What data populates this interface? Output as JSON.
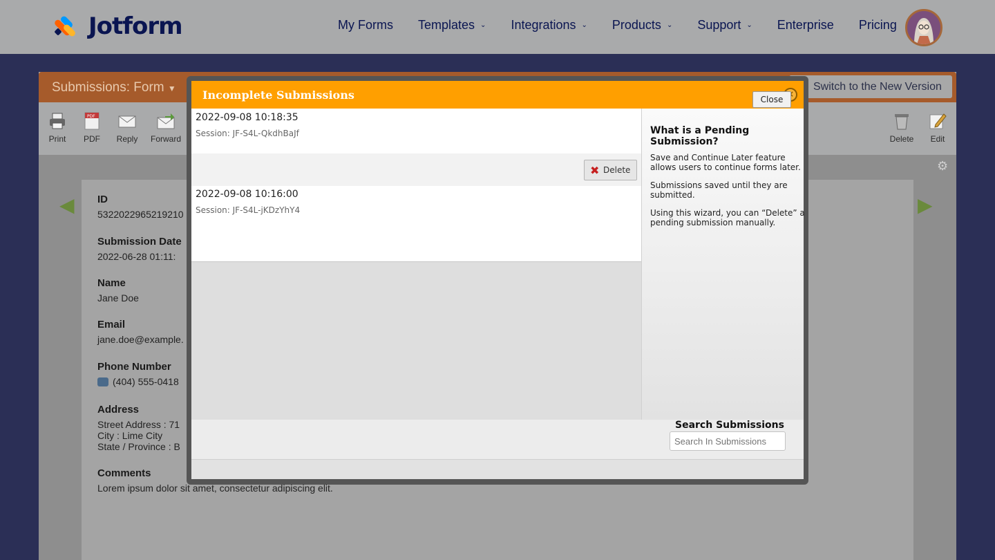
{
  "brand": {
    "name": "Jotform",
    "colors": [
      "#0099ff",
      "#ff6100",
      "#ffb629",
      "#0a1551"
    ]
  },
  "nav": {
    "items": [
      {
        "label": "My Forms",
        "dropdown": false
      },
      {
        "label": "Templates",
        "dropdown": true
      },
      {
        "label": "Integrations",
        "dropdown": true
      },
      {
        "label": "Products",
        "dropdown": true
      },
      {
        "label": "Support",
        "dropdown": true
      },
      {
        "label": "Enterprise",
        "dropdown": false
      },
      {
        "label": "Pricing",
        "dropdown": false
      }
    ],
    "avatar_icon": "user-avatar-icon"
  },
  "submissions": {
    "title": "Submissions: Form",
    "switch_label": "Switch to the New Version",
    "toolbar": {
      "print": "Print",
      "pdf": "PDF",
      "reply": "Reply",
      "forward": "Forward",
      "delete": "Delete",
      "edit": "Edit"
    },
    "fields": [
      {
        "label": "ID",
        "value": "5322022965219210"
      },
      {
        "label": "Submission Date",
        "value": "2022-06-28 01:11:"
      },
      {
        "label": "Name",
        "value": "Jane Doe"
      },
      {
        "label": "Email",
        "value": "jane.doe@example."
      },
      {
        "label": "Phone Number",
        "value": "(404) 555-0418"
      },
      {
        "label": "Address",
        "value": "Street Address : 71",
        "value2": "City : Lime City",
        "value3": "State / Province : B"
      },
      {
        "label": "Comments",
        "value": "Lorem ipsum dolor sit amet, consectetur adipiscing elit."
      }
    ]
  },
  "modal": {
    "title": "Incomplete Submissions",
    "entries": [
      {
        "date": "2022-09-08 10:18:35",
        "session": "Session: JF-S4L-QkdhBaJf"
      },
      {
        "date": "2022-09-08 10:16:00",
        "session": "Session: JF-S4L-jKDzYhY4"
      }
    ],
    "delete_label": "Delete",
    "side": {
      "title": "What is a Pending Submission?",
      "p1": "Save and Continue Later feature allows users to continue forms later.",
      "p2": "Submissions saved until they are submitted.",
      "p3": "Using this wizard, you can “Delete” a pending submission manually."
    },
    "search_label": "Search Submissions",
    "search_placeholder": "Search In Submissions",
    "close_label": "Close",
    "header_color": "#ff9f00"
  }
}
